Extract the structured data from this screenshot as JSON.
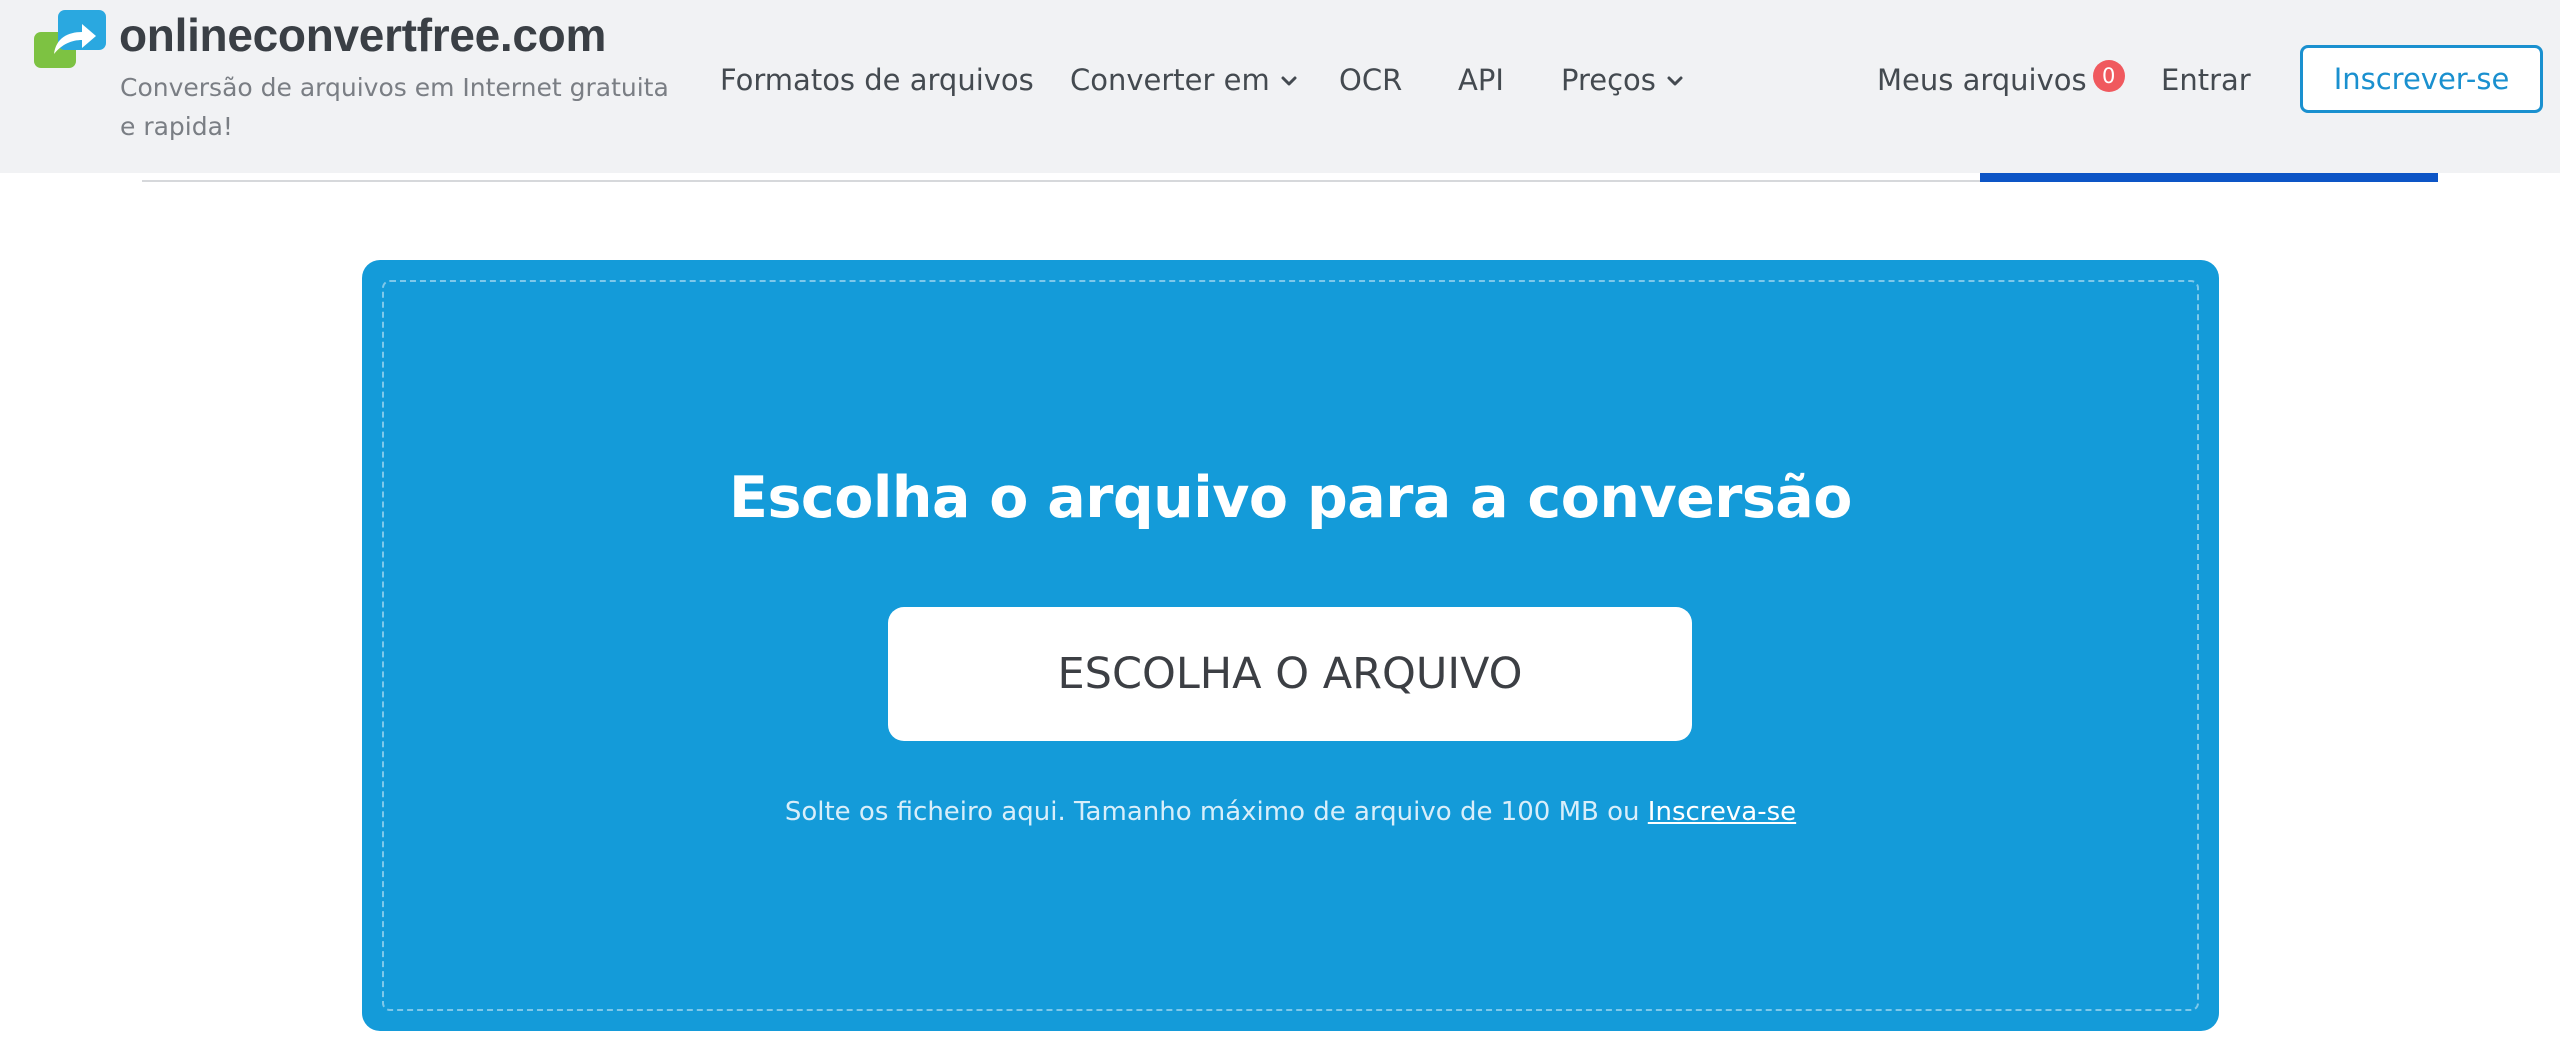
{
  "brand": {
    "name": "onlineconvertfree.com",
    "tagline": "Conversão de arquivos em Internet gratuita e rapida!"
  },
  "nav": {
    "file_formats": "Formatos de arquivos",
    "convert_to": "Converter em",
    "ocr": "OCR",
    "api": "API",
    "prices": "Preços",
    "my_files": "Meus arquivos",
    "my_files_count": "0",
    "login": "Entrar",
    "signup": "Inscrever-se"
  },
  "upload": {
    "title": "Escolha o arquivo para a conversão",
    "button": "ESCOLHA O ARQUIVO",
    "hint": "Solte os ficheiro aqui. Tamanho máximo de arquivo de 100 MB ou",
    "hint_link": "Inscreva-se"
  },
  "colors": {
    "accent": "#149bd9",
    "signup_border": "#1a90cf",
    "badge": "#f0595e",
    "logo_blue": "#2aa8e0",
    "logo_green": "#7dc242",
    "tab_active": "#0d55c6"
  },
  "icons": {
    "logo": "logo-icon",
    "dropdown": "chevron-down-icon"
  }
}
